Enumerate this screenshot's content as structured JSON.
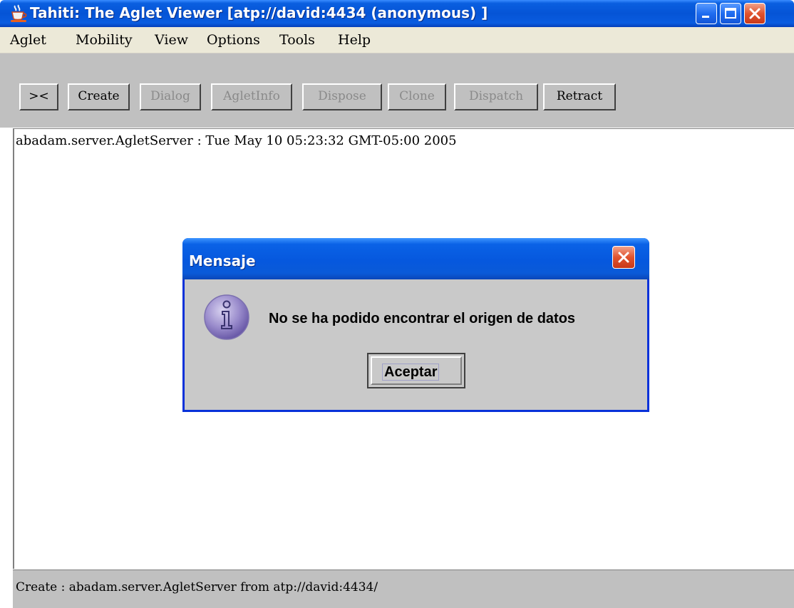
{
  "window": {
    "title": "Tahiti: The Aglet Viewer [atp://david:4434 (anonymous) ]",
    "title_color": "#0554d6"
  },
  "menu": {
    "items": [
      "Aglet",
      "Mobility",
      "View",
      "Options",
      "Tools",
      "Help"
    ]
  },
  "toolbar": {
    "toggle_label": "><",
    "create_label": "Create",
    "dialog_label": "Dialog",
    "agletinfo_label": "AgletInfo",
    "dispose_label": "Dispose",
    "clone_label": "Clone",
    "dispatch_label": "Dispatch",
    "retract_label": "Retract"
  },
  "content": {
    "log_line": "abadam.server.AgletServer : Tue May 10 05:23:32 GMT-05:00 2005"
  },
  "status": {
    "text": "Create : abadam.server.AgletServer from atp://david:4434/"
  },
  "dialog": {
    "title": "Mensaje",
    "message": "No se ha podido encontrar el origen de datos",
    "button_label": "Aceptar",
    "icon": "info-icon"
  },
  "icons": {
    "app": "java-cup-icon",
    "minimize": "minimize-icon",
    "maximize": "maximize-icon",
    "close": "close-icon"
  }
}
